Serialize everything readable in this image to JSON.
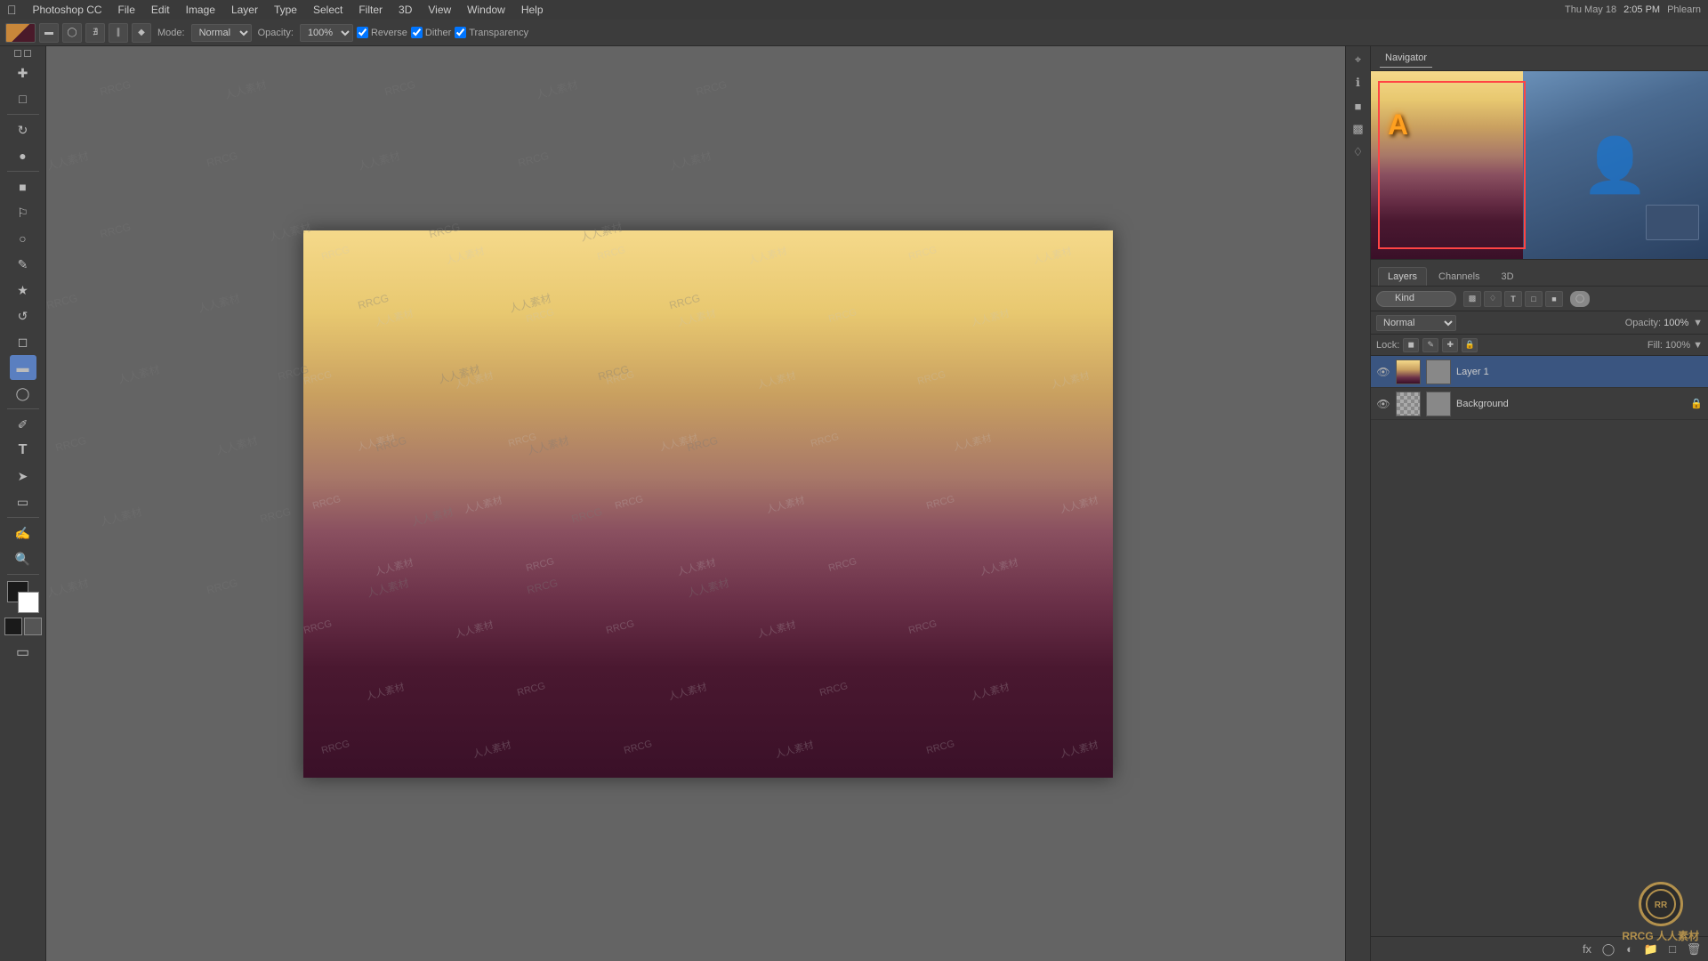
{
  "app": {
    "name": "Photoshop CC",
    "title": "Photoshop CC"
  },
  "menu": {
    "items": [
      "File",
      "Edit",
      "Image",
      "Layer",
      "Type",
      "Select",
      "Filter",
      "3D",
      "View",
      "Window",
      "Help"
    ]
  },
  "toolbar": {
    "mode_label": "Mode:",
    "mode_value": "Normal",
    "opacity_label": "Opacity:",
    "opacity_value": "100%",
    "reverse_label": "Reverse",
    "dither_label": "Dither",
    "transparency_label": "Transparency"
  },
  "navigator": {
    "title": "Navigator"
  },
  "layers_panel": {
    "tabs": [
      "Layers",
      "Channels",
      "3D"
    ],
    "active_tab": "Layers",
    "blend_mode": "Normal",
    "opacity_label": "Opacity:",
    "opacity_value": "100%",
    "fill_label": "Fill:",
    "fill_value": "100%",
    "lock_label": "Lock:",
    "search_placeholder": "Kind",
    "layers": [
      {
        "name": "Layer 1",
        "type": "gradient",
        "visible": true,
        "selected": true,
        "locked": false
      },
      {
        "name": "Background",
        "type": "bg",
        "visible": true,
        "selected": false,
        "locked": true
      }
    ],
    "bottom_actions": [
      "fx",
      "adjustment",
      "group",
      "new",
      "delete"
    ]
  },
  "clock": {
    "time": "2:05 PM",
    "day": "Thu May 18"
  },
  "user": "Phlearn"
}
